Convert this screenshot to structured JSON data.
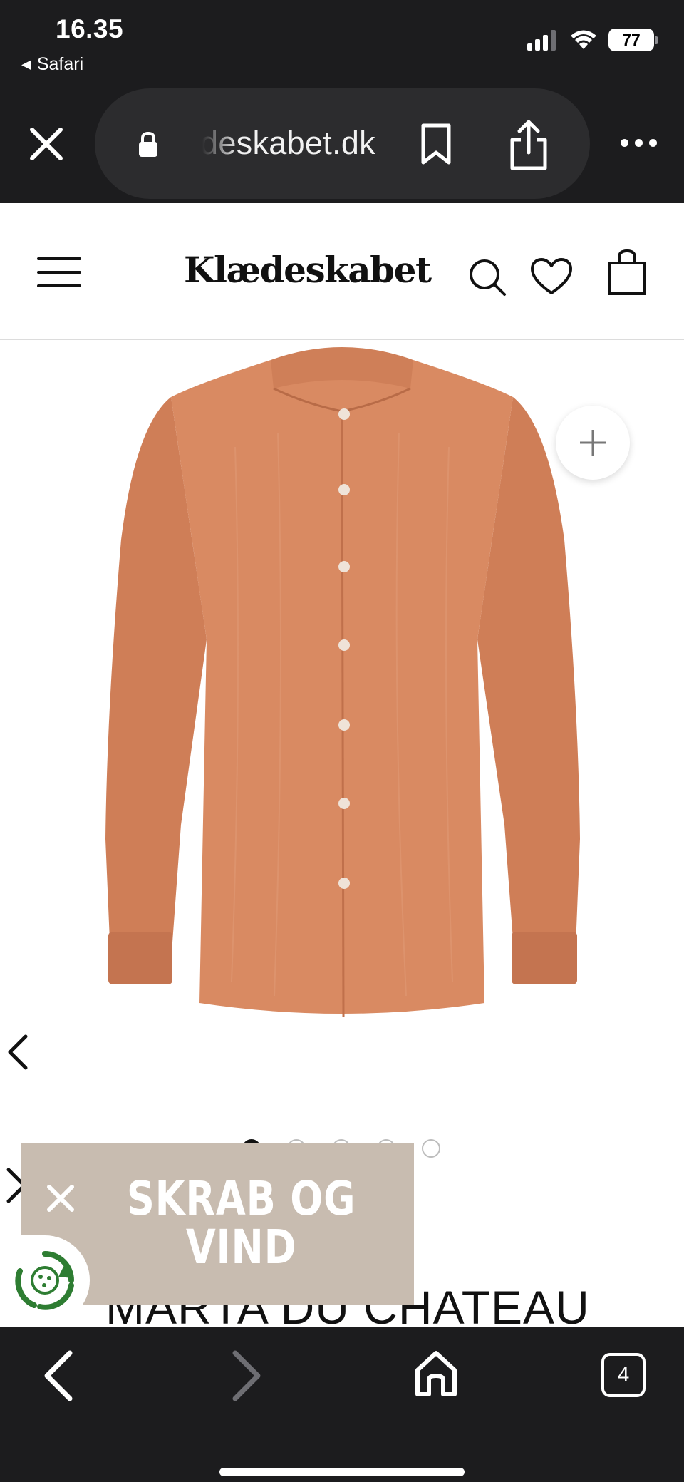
{
  "status_bar": {
    "time": "16.35",
    "back_app": "Safari",
    "battery": "77"
  },
  "browser": {
    "url_display": "deskabet.dk",
    "open_tabs": "4"
  },
  "site": {
    "logo": "Klædeskabet"
  },
  "gallery": {
    "image_count": 5,
    "active_index": 0
  },
  "product": {
    "brand": "MARTA DU CHATEAU"
  },
  "promo": {
    "label": "SKRAB OG VIND",
    "bg_color": "#c8bcb0"
  },
  "colors": {
    "chrome_bg": "#1c1c1e",
    "shirt": "#d98a62",
    "eco_green": "#2e7d32"
  },
  "icons": {
    "close_tab": "close-icon",
    "lock": "lock-icon",
    "bookmark": "bookmark-icon",
    "share": "share-icon",
    "more": "more-icon",
    "menu": "hamburger-icon",
    "search": "search-icon",
    "wishlist": "heart-icon",
    "bag": "bag-icon",
    "zoom": "plus-icon",
    "home": "home-icon",
    "eco": "recycle-icon"
  }
}
